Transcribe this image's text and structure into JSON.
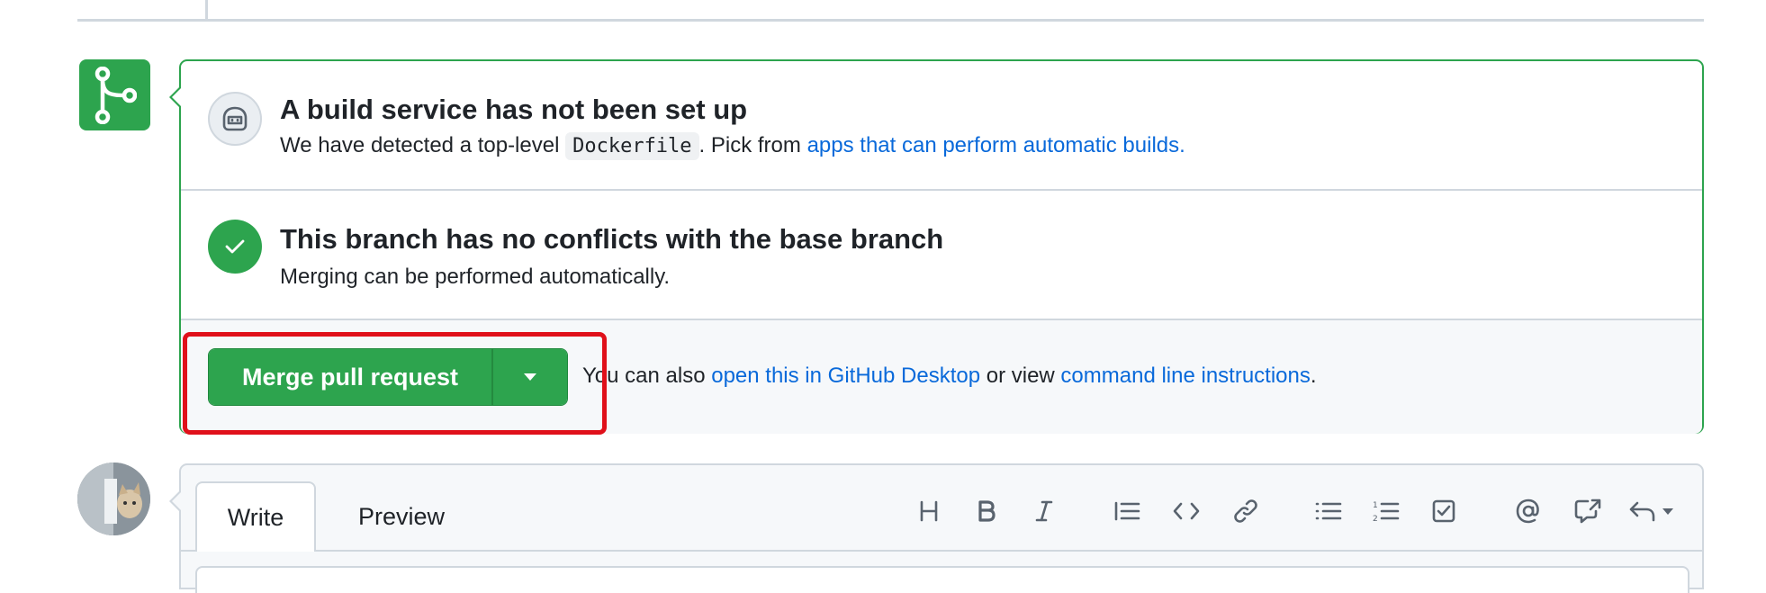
{
  "merge_box": {
    "build_service": {
      "title": "A build service has not been set up",
      "desc_prefix": "We have detected a top-level ",
      "code": "Dockerfile",
      "desc_middle": ". Pick from ",
      "link": "apps that can perform automatic builds."
    },
    "conflicts": {
      "title": "This branch has no conflicts with the base branch",
      "desc": "Merging can be performed automatically."
    },
    "merge": {
      "button_label": "Merge pull request",
      "alt_prefix": "You can also ",
      "desktop_link": "open this in GitHub Desktop",
      "alt_middle": " or view ",
      "cli_link": "command line instructions",
      "alt_suffix": "."
    }
  },
  "comment": {
    "tabs": [
      "Write",
      "Preview"
    ],
    "toolbar": [
      "heading-icon",
      "bold-icon",
      "italic-icon",
      "quote-icon",
      "code-icon",
      "link-icon",
      "unordered-list-icon",
      "ordered-list-icon",
      "task-list-icon",
      "mention-icon",
      "cross-reference-icon",
      "saved-replies-icon"
    ]
  },
  "colors": {
    "success": "#2da44e",
    "link": "#0969da",
    "highlight": "#e0101a",
    "border": "#d0d7de"
  }
}
